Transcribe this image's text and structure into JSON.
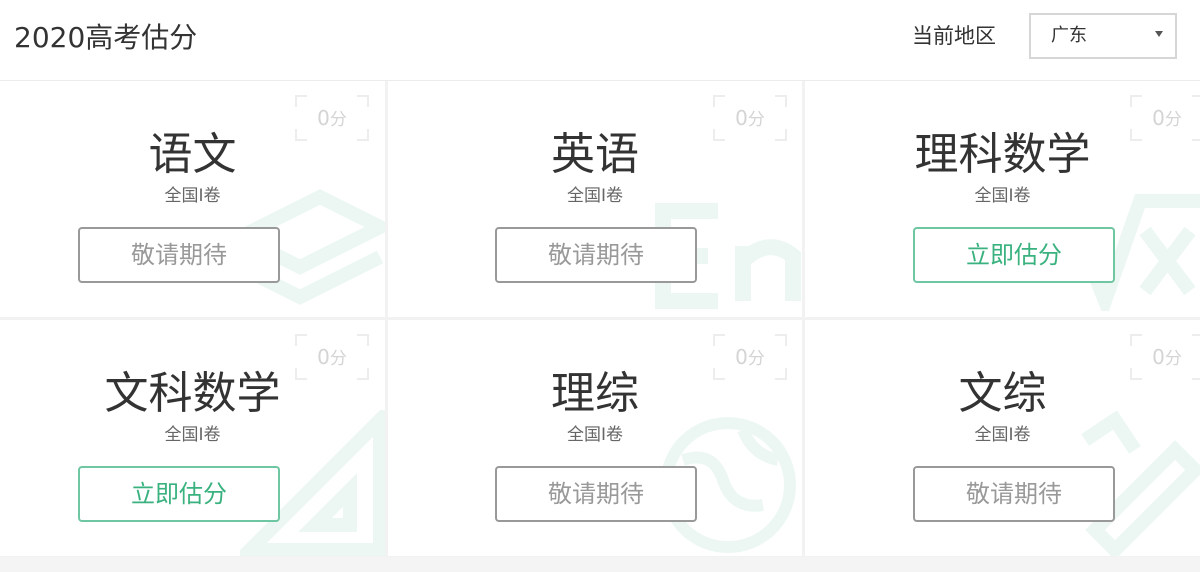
{
  "header": {
    "title": "2020高考估分",
    "region_label": "当前地区",
    "region_value": "广东"
  },
  "colors": {
    "active_green": "#3ab27f",
    "disabled_gray": "#999999"
  },
  "cards": [
    {
      "subject": "语文",
      "paper": "全国I卷",
      "score": "0",
      "score_unit": "分",
      "button": "敬请期待",
      "active": false,
      "watermark": "books-icon"
    },
    {
      "subject": "英语",
      "paper": "全国I卷",
      "score": "0",
      "score_unit": "分",
      "button": "敬请期待",
      "active": false,
      "watermark": "english-letters-icon"
    },
    {
      "subject": "理科数学",
      "paper": "全国I卷",
      "score": "0",
      "score_unit": "分",
      "button": "立即估分",
      "active": true,
      "watermark": "square-root-icon"
    },
    {
      "subject": "文科数学",
      "paper": "全国I卷",
      "score": "0",
      "score_unit": "分",
      "button": "立即估分",
      "active": true,
      "watermark": "ruler-triangle-icon"
    },
    {
      "subject": "理综",
      "paper": "全国I卷",
      "score": "0",
      "score_unit": "分",
      "button": "敬请期待",
      "active": false,
      "watermark": "globe-icon"
    },
    {
      "subject": "文综",
      "paper": "全国I卷",
      "score": "0",
      "score_unit": "分",
      "button": "敬请期待",
      "active": false,
      "watermark": "pencil-ruler-icon"
    }
  ]
}
